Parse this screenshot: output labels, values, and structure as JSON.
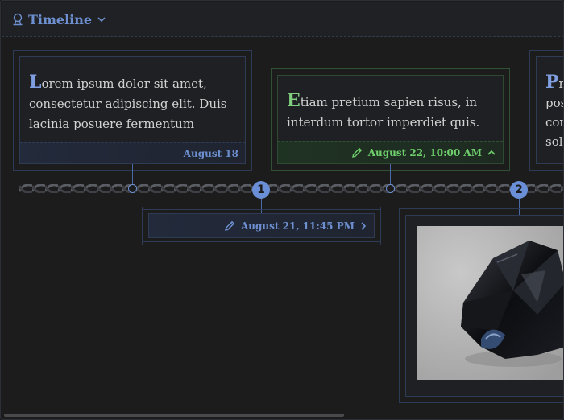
{
  "header": {
    "title": "Timeline",
    "icon": "award-ribbon-icon",
    "dropdown_icon": "chevron-down-icon",
    "accent": "#6d8fd0"
  },
  "cards": [
    {
      "id": "card-1",
      "dropcap": "L",
      "text": "orem ipsum dolor sit amet, consectetur adipiscing elit. Duis lacinia posuere fermentum",
      "date": "August 18"
    },
    {
      "id": "card-2",
      "dropcap": "E",
      "text": "tiam pretium sapien risus, in interdum tortor imperdiet quis.",
      "date": "August 22, 10:00 AM",
      "accent": "#6fcf6c",
      "expanded": true
    },
    {
      "id": "card-3",
      "dropcap": "P",
      "text_lines": [
        "re",
        "pos",
        "cor",
        "soll"
      ]
    }
  ],
  "markers": [
    {
      "label": "1"
    },
    {
      "label": "2"
    }
  ],
  "lower_card": {
    "date": "August 21, 11:45 PM"
  },
  "image_card": {
    "subject": "black obsidian stone"
  }
}
